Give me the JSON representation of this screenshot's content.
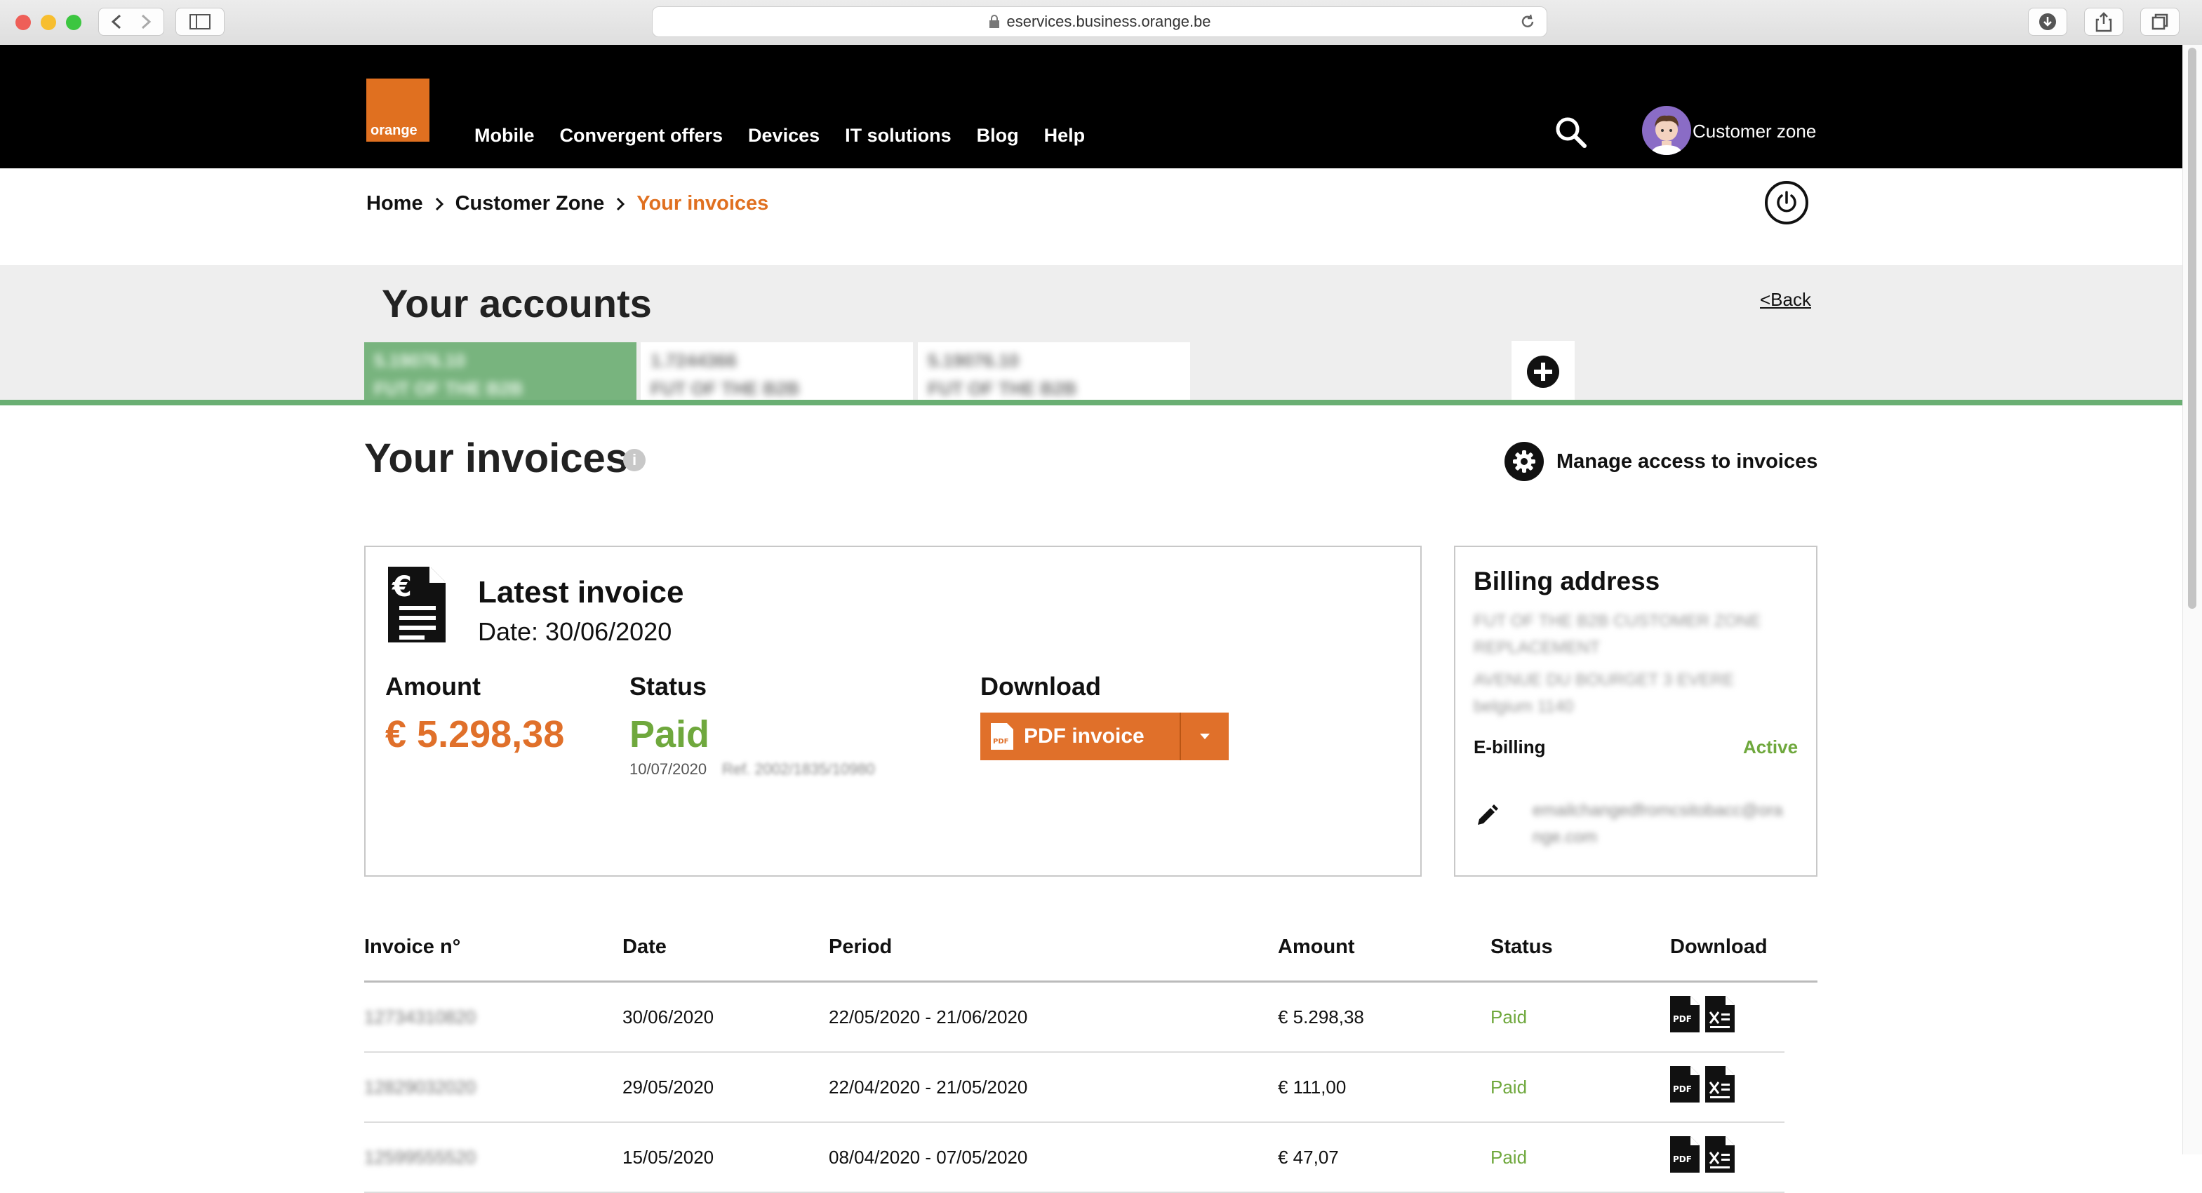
{
  "browser": {
    "url": "eservices.business.orange.be"
  },
  "header": {
    "logo_text": "orange",
    "nav": [
      "Mobile",
      "Convergent offers",
      "Devices",
      "IT solutions",
      "Blog",
      "Help"
    ],
    "customer_zone": "Customer zone"
  },
  "breadcrumb": {
    "items": [
      "Home",
      "Customer Zone",
      "Your invoices"
    ],
    "current_color": "#e07020"
  },
  "accounts": {
    "title": "Your accounts",
    "back_label": "<Back",
    "tabs": [
      {
        "line1": "5.19076.10",
        "line2": "FUT OF THE B2B",
        "active": true
      },
      {
        "line1": "1.7244366",
        "line2": "FUT OF THE B2B",
        "active": false
      },
      {
        "line1": "5.19076.10",
        "line2": "FUT OF THE B2B",
        "active": false
      }
    ]
  },
  "invoices": {
    "title": "Your invoices",
    "manage_access": "Manage access to invoices"
  },
  "latest_invoice": {
    "title": "Latest invoice",
    "date_label": "Date: ",
    "date": "30/06/2020",
    "amount_label": "Amount",
    "amount": "€ 5.298,38",
    "status_label": "Status",
    "status": "Paid",
    "paid_date": "10/07/2020",
    "ref_text": "Ref. 2002/1835/10980",
    "download_label": "Download",
    "pdf_button": "PDF invoice",
    "pdf_icon_text": "PDF"
  },
  "billing": {
    "title": "Billing address",
    "address_lines": [
      "FUT OF THE B2B CUSTOMER ZONE",
      "REPLACEMENT",
      "AVENUE DU BOURGET 3 EVERE",
      "belgium 1140"
    ],
    "ebilling_label": "E-billing",
    "ebilling_status": "Active",
    "email_lines": [
      "emailchangedfromcsitobacc@ora",
      "nge.com"
    ]
  },
  "table": {
    "headers": [
      "Invoice n°",
      "Date",
      "Period",
      "Amount",
      "Status",
      "Download"
    ],
    "rows": [
      {
        "invoice_no": "12734310820",
        "date": "30/06/2020",
        "period": "22/05/2020 - 21/06/2020",
        "amount": "€ 5.298,38",
        "status": "Paid"
      },
      {
        "invoice_no": "12829032020",
        "date": "29/05/2020",
        "period": "22/04/2020 - 21/05/2020",
        "amount": "€ 111,00",
        "status": "Paid"
      },
      {
        "invoice_no": "12599555520",
        "date": "15/05/2020",
        "period": "08/04/2020 - 07/05/2020",
        "amount": "€ 47,07",
        "status": "Paid"
      }
    ],
    "pdf_icon_text": "PDF"
  },
  "colors": {
    "orange": "#e07020",
    "green_status": "#6fa83d",
    "account_green": "#78b47e"
  }
}
